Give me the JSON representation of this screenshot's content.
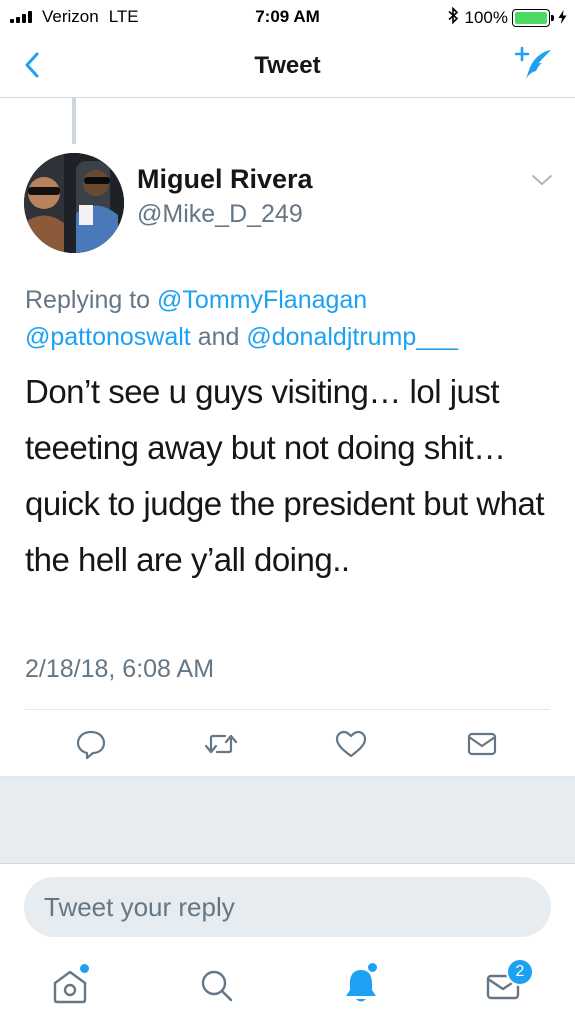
{
  "status_bar": {
    "carrier": "Verizon",
    "network": "LTE",
    "time": "7:09 AM",
    "battery": "100%",
    "battery_level": 1.0
  },
  "nav": {
    "title": "Tweet",
    "back_icon": "chevron-left-icon",
    "compose_icon": "compose-tweet-icon"
  },
  "tweet": {
    "display_name": "Miguel Rivera",
    "handle": "@Mike_D_249",
    "replying_to_label": "Replying to",
    "mention_1": "@TommyFlanagan",
    "mention_2": "@pattonoswalt",
    "and_label": "and",
    "mention_3": "@donaldjtrump___",
    "text": "Don’t see u guys visiting… lol just teeeting away but not doing shit… quick to judge the president but what the hell are y’all doing..",
    "timestamp": "2/18/18, 6:08 AM"
  },
  "actions": [
    "reply-icon",
    "retweet-icon",
    "like-icon",
    "direct-message-icon"
  ],
  "reply_box": {
    "placeholder": "Tweet your reply"
  },
  "tabbar": {
    "items": [
      "home-icon",
      "search-icon",
      "notifications-icon",
      "messages-icon"
    ],
    "messages_badge": "2"
  },
  "colors": {
    "accent": "#1da1f2",
    "secondary_text": "#657786",
    "primary_text": "#14171a",
    "battery_green": "#4cd964"
  }
}
